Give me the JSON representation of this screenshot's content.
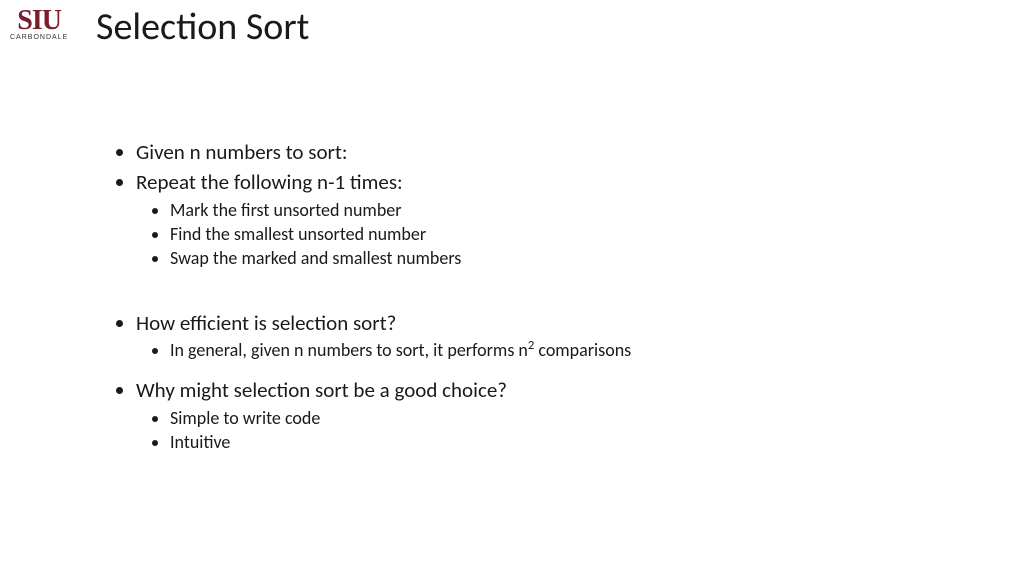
{
  "logo": {
    "main": "SIU",
    "sub": "CARBONDALE"
  },
  "title": "Selection Sort",
  "bullets": {
    "b1": "Given n numbers to sort:",
    "b2": "Repeat the following n-1 times:",
    "b2_sub": [
      "Mark the first unsorted number",
      "Find the smallest unsorted number",
      "Swap the marked and smallest numbers"
    ],
    "b3": "How efficient is selection sort?",
    "b3_sub_prefix": "In general, given n numbers to sort, it performs n",
    "b3_sub_sup": "2",
    "b3_sub_suffix": " comparisons",
    "b4": "Why might selection sort be a good choice?",
    "b4_sub": [
      "Simple to write code",
      "Intuitive"
    ]
  }
}
